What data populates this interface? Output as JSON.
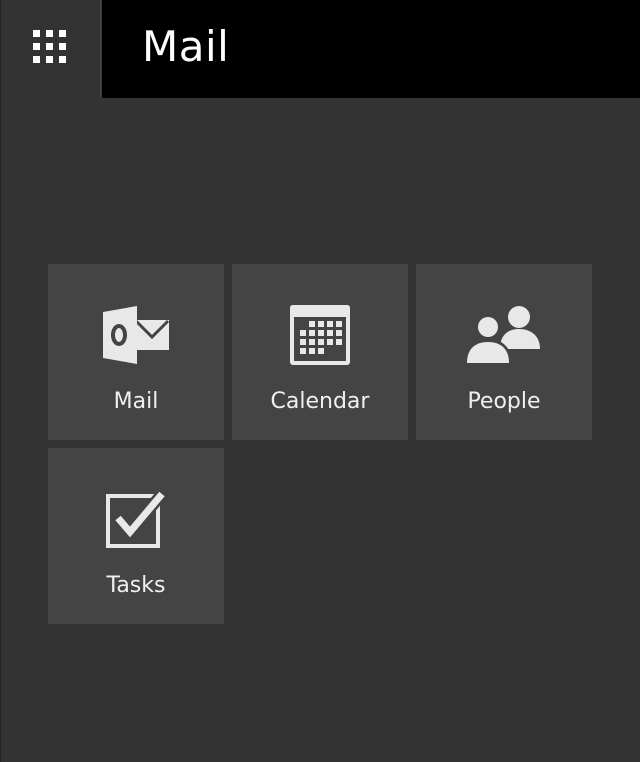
{
  "header": {
    "app_title": "Mail",
    "launcher_icon": "app-launcher-grid-icon"
  },
  "tiles": [
    {
      "label": "Mail",
      "icon": "outlook-mail-icon"
    },
    {
      "label": "Calendar",
      "icon": "calendar-icon"
    },
    {
      "label": "People",
      "icon": "people-icon"
    },
    {
      "label": "Tasks",
      "icon": "tasks-checkbox-icon"
    }
  ],
  "colors": {
    "background": "#333333",
    "titlebar": "#000000",
    "tile": "#444444",
    "text": "#ffffff"
  }
}
